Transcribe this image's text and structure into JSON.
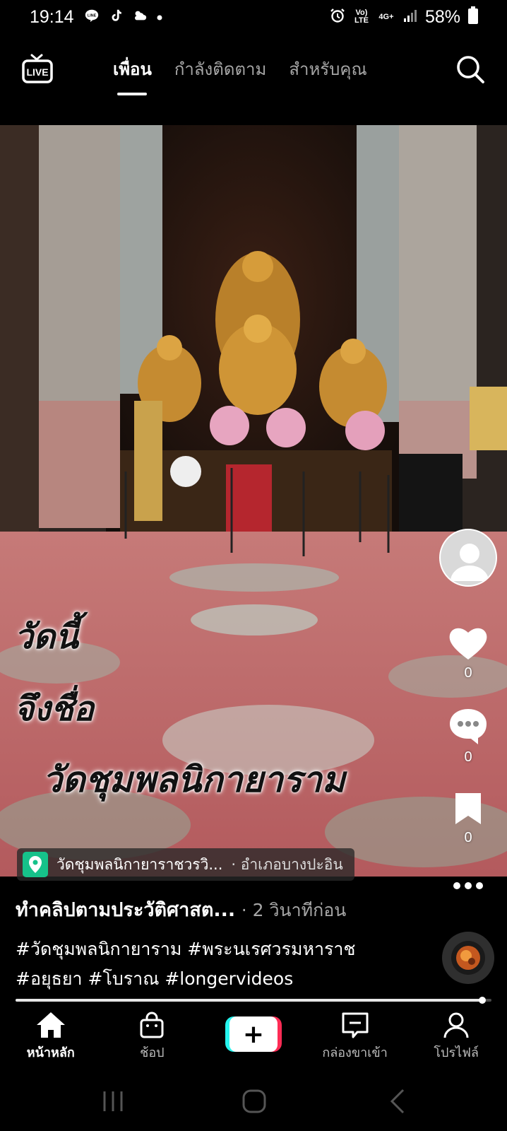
{
  "status_bar": {
    "time": "19:14",
    "left_icons": [
      "line-icon",
      "tiktok-icon",
      "weather-icon",
      "dot-icon"
    ],
    "right_icons": [
      "alarm-icon",
      "volte-icon",
      "4g-icon",
      "signal-icon",
      "battery-icon"
    ],
    "volte_label": "Vo) LTE",
    "net_label": "4G+",
    "battery": "58%"
  },
  "top_nav": {
    "live_label": "LIVE",
    "tabs": [
      {
        "label": "เพื่อน",
        "active": true
      },
      {
        "label": "กำลังติดตาม",
        "active": false
      },
      {
        "label": "สำหรับคุณ",
        "active": false
      }
    ]
  },
  "video": {
    "overlay_lines": [
      "วัดนี้",
      "จึงชื่อ",
      "วัดชุมพลนิกายาราม"
    ]
  },
  "rail": {
    "like_count": "0",
    "comment_count": "0",
    "bookmark_count": "0"
  },
  "location": {
    "place": "วัดชุมพลนิกายาราชวรวิ...",
    "district": "· อำเภอบางปะอิน"
  },
  "caption": {
    "author": "ทำคลิปตามประวัติศาสต...",
    "time": "· 2 วินาทีก่อน",
    "tags_line1": "#วัดชุมพลนิกายาราม #พระนเรศวรมหาราช",
    "tags_line2": "#อยุธยา #โบราณ #longervideos"
  },
  "progress": 0.98,
  "tabbar": {
    "items": [
      {
        "label": "หน้าหลัก",
        "icon": "home-icon",
        "active": true
      },
      {
        "label": "ช้อป",
        "icon": "shop-bag-icon",
        "active": false
      },
      {
        "label": "",
        "icon": "create-plus-icon",
        "active": false
      },
      {
        "label": "กล่องขาเข้า",
        "icon": "inbox-icon",
        "active": false
      },
      {
        "label": "โปรไฟล์",
        "icon": "profile-icon",
        "active": false
      }
    ]
  },
  "colors": {
    "background": "#000000",
    "accent_cyan": "#25f4ee",
    "accent_red": "#fe2c55",
    "location_pin": "#16c28a"
  }
}
